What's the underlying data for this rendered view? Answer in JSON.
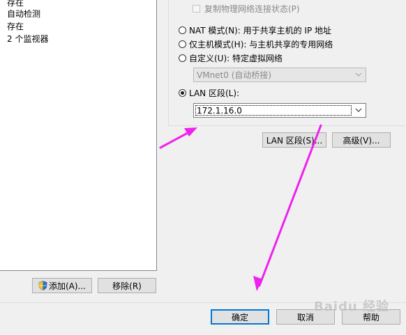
{
  "left_list": {
    "rows": [
      "存在",
      "自动检测",
      "存在",
      "2 个监视器"
    ]
  },
  "network": {
    "replicate_physical_label": "复制物理网络连接状态(P)",
    "nat_label": "NAT 模式(N): 用于共享主机的 IP 地址",
    "host_only_label": "仅主机模式(H): 与主机共享的专用网络",
    "custom_label": "自定义(U): 特定虚拟网络",
    "custom_select_value": "VMnet0 (自动桥接)",
    "lan_segment_label": "LAN 区段(L):",
    "lan_segment_value": "172.1.16.0",
    "selected": "lan_segment"
  },
  "buttons": {
    "lan_segments": "LAN 区段(S)...",
    "advanced": "高级(V)...",
    "add": "添加(A)...",
    "remove": "移除(R)",
    "ok": "确定",
    "cancel": "取消",
    "help": "帮助"
  },
  "watermark": "Baidu 经验",
  "colors": {
    "annotation_arrow": "#ee22ee",
    "focus_border": "#0078d7"
  },
  "icons": [
    "shield-icon",
    "chevron-down-icon"
  ]
}
